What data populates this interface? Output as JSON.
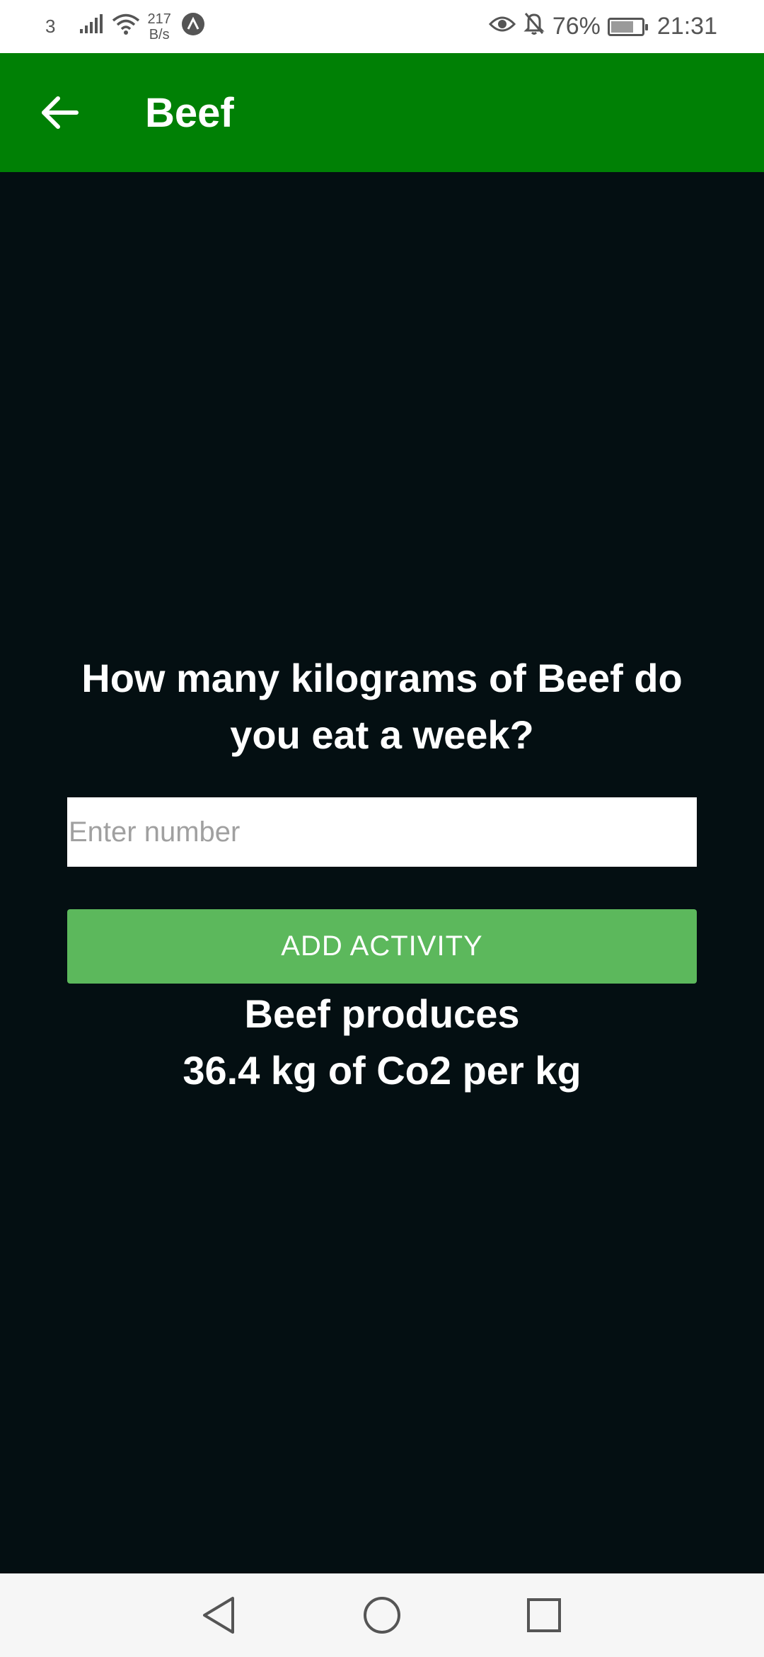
{
  "status_bar": {
    "carrier": "3",
    "net_speed_value": "217",
    "net_speed_unit": "B/s",
    "battery_percent": "76%",
    "battery_level": 0.76,
    "time": "21:31",
    "icons": [
      "signal-icon",
      "wifi-icon",
      "app-notification-icon",
      "eye-icon",
      "bell-off-icon",
      "battery-icon"
    ]
  },
  "app_bar": {
    "title": "Beef",
    "background_color": "#008005"
  },
  "main": {
    "question": "How many kilograms of Beef do you eat a week?",
    "input_placeholder": "Enter number",
    "input_value": "",
    "button_label": "ADD ACTIVITY",
    "button_color": "#5cb85c",
    "result_line1": "Beef produces",
    "result_line2": "36.4 kg of Co2 per kg"
  },
  "nav_bar": {
    "icons": [
      "back-triangle-icon",
      "home-circle-icon",
      "recents-square-icon"
    ]
  }
}
